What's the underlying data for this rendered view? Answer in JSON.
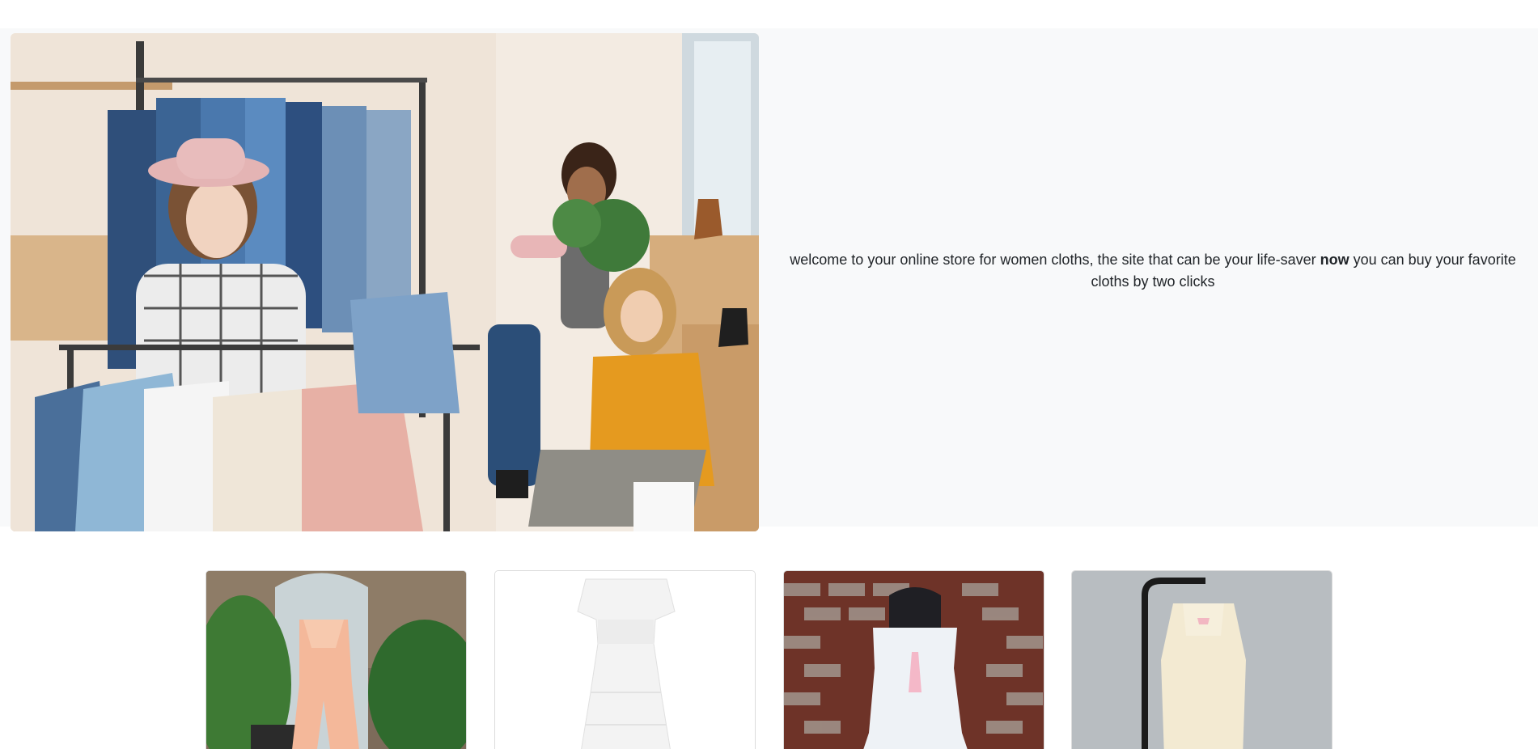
{
  "hero": {
    "image_alt": "Women shopping for clothes in a boutique",
    "text_before": "welcome to your online store for women cloths, the site that can be your life-saver ",
    "text_bold": "now",
    "text_after": " you can buy your favorite cloths by two clicks"
  },
  "products": {
    "items": [
      {
        "alt": "Peach silk romper on mannequin",
        "bg": "#8a7a6a",
        "garment": "#f4b89a"
      },
      {
        "alt": "White off-shoulder tiered dress",
        "bg": "#ffffff",
        "garment": "#f1f1f1"
      },
      {
        "alt": "White lace babydoll dress on brick wall",
        "bg": "#7a3b30",
        "garment": "#eef2f6"
      },
      {
        "alt": "Cream vintage slip dress on dress form",
        "bg": "#b9bec2",
        "garment": "#f3ead2"
      }
    ]
  },
  "colors": {
    "hero_bg": "#f8f9fa",
    "text": "#212529"
  }
}
